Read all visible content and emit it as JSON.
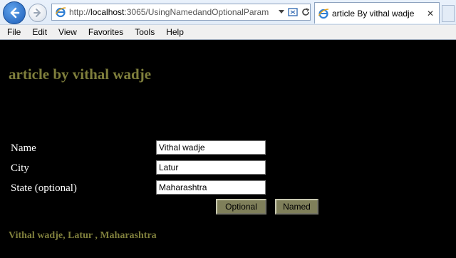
{
  "browser": {
    "url_prefix": "http://",
    "url_host": "localhost",
    "url_rest": ":3065/UsingNamedandOptionalParam",
    "tab_title": "article By vithal wadje",
    "menu": [
      "File",
      "Edit",
      "View",
      "Favorites",
      "Tools",
      "Help"
    ]
  },
  "page": {
    "title": "article by vithal wadje",
    "form": {
      "name_label": "Name",
      "name_value": "Vithal wadje",
      "city_label": "City",
      "city_value": "Latur",
      "state_label": "State (optional)",
      "state_value": "Maharashtra"
    },
    "buttons": {
      "optional": "Optional",
      "named": "Named"
    },
    "result": "Vithal wadje, Latur , Maharashtra"
  },
  "colors": {
    "page_background": "#000000",
    "title_color": "#7f7f3c",
    "button_background": "#7f7f5a",
    "browser_accent": "#1c5cb7"
  },
  "icons": [
    "back-arrow-icon",
    "forward-arrow-icon",
    "ie-page-icon",
    "dropdown-icon",
    "compat-view-icon",
    "refresh-icon",
    "close-icon"
  ]
}
